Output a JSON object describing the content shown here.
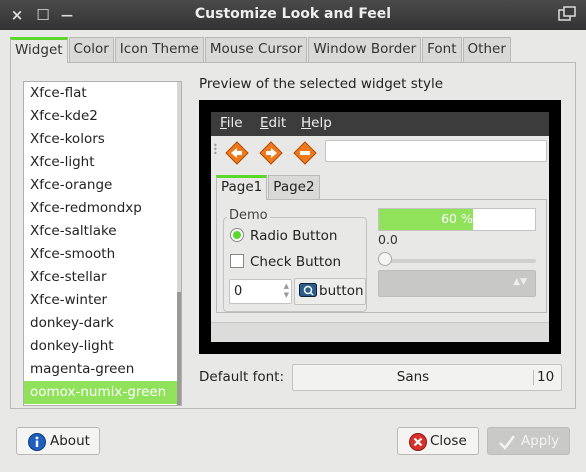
{
  "window": {
    "title": "Customize Look and Feel",
    "close_glyph": "×",
    "menu_glyph": "☐",
    "minimize_glyph": "—"
  },
  "tabs": [
    "Widget",
    "Color",
    "Icon Theme",
    "Mouse Cursor",
    "Window Border",
    "Font",
    "Other"
  ],
  "themes": {
    "items": [
      "Xfce-flat",
      "Xfce-kde2",
      "Xfce-kolors",
      "Xfce-light",
      "Xfce-orange",
      "Xfce-redmondxp",
      "Xfce-saltlake",
      "Xfce-smooth",
      "Xfce-stellar",
      "Xfce-winter",
      "donkey-dark",
      "donkey-light",
      "magenta-green",
      "oomox-numix-green"
    ],
    "selected": "oomox-numix-green"
  },
  "preview": {
    "label": "Preview of the selected widget style",
    "menu": {
      "file": {
        "underlined": "F",
        "rest": "ile"
      },
      "edit": {
        "underlined": "E",
        "rest": "dit"
      },
      "help": {
        "underlined": "H",
        "rest": "elp"
      }
    },
    "tabs": [
      "Page1",
      "Page2"
    ],
    "demo_legend": "Demo",
    "radio_label": "Radio Button",
    "check_label": "Check Button",
    "spin_value": "0",
    "image_button_label": "button",
    "progress_text": "60 %",
    "progress_fraction": 0.6,
    "scale_value": "0.0"
  },
  "font": {
    "label": "Default font:",
    "name": "Sans",
    "size": "10"
  },
  "buttons": {
    "about": "About",
    "close": "Close",
    "apply": "Apply"
  },
  "colors": {
    "accent": "#8fe25a",
    "titlebar": "#3a3a3a",
    "arrow_icons": "#f07a1a"
  }
}
